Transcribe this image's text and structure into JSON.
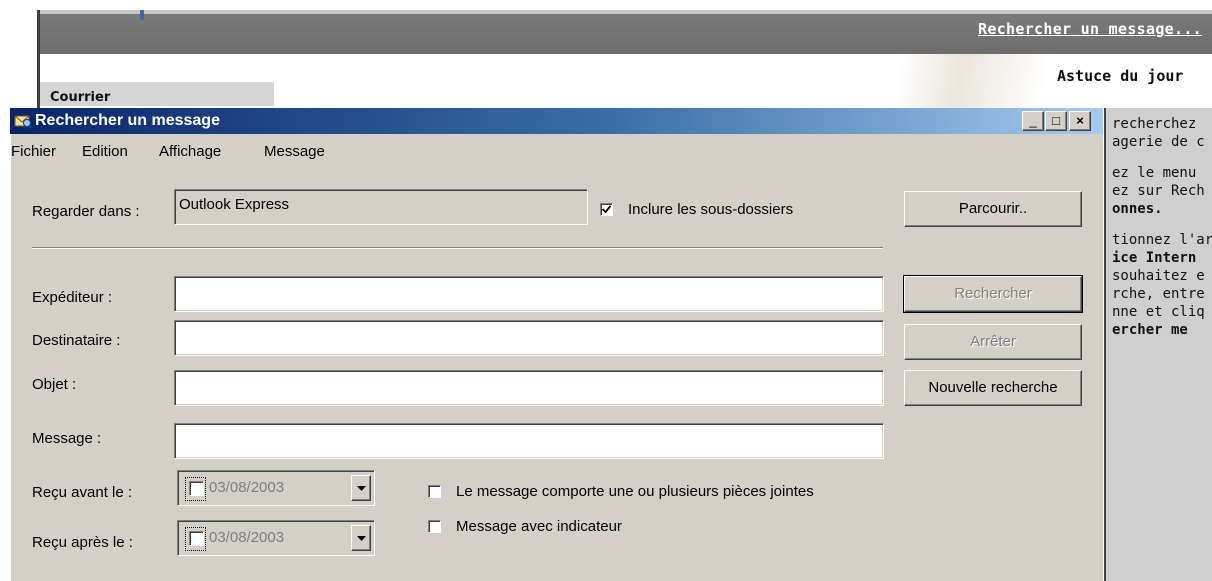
{
  "background": {
    "header_link": "Rechercher un message...",
    "side_tab": "Courrier",
    "tip_title": "Astuce du jour",
    "tip_lines": [
      "recherchez",
      "agerie de c",
      "",
      "ez le menu",
      "ez sur Rech",
      "onnes.",
      "",
      "tionnez l'ar",
      "ice Intern",
      "souhaitez e",
      "rche, entre",
      "nne et cliq",
      "ercher me"
    ]
  },
  "dialog": {
    "title": "Rechercher un message",
    "window_buttons": {
      "minimize": "_",
      "maximize": "□",
      "close": "×"
    },
    "menu": [
      "Fichier",
      "Edition",
      "Affichage",
      "Message"
    ],
    "look_in": {
      "label": "Regarder dans :",
      "value": "Outlook Express",
      "include_subfolders_label": "Inclure les sous-dossiers",
      "include_subfolders_checked": true,
      "browse_button": "Parcourir.."
    },
    "fields": {
      "from": {
        "label": "Expéditeur :",
        "value": ""
      },
      "to": {
        "label": "Destinataire :",
        "value": ""
      },
      "subject": {
        "label": "Objet :",
        "value": ""
      },
      "message": {
        "label": "Message :",
        "value": ""
      }
    },
    "buttons": {
      "search": "Rechercher",
      "stop": "Arrêter",
      "new_search": "Nouvelle recherche"
    },
    "received_before": {
      "label": "Reçu avant le :",
      "date": "03/08/2003",
      "checked": false
    },
    "received_after": {
      "label": "Reçu après le :",
      "date": "03/08/2003",
      "checked": false
    },
    "options": {
      "has_attachments": {
        "label": "Le message comporte une ou plusieurs pièces jointes",
        "checked": false
      },
      "flagged": {
        "label": "Message avec indicateur",
        "checked": false
      }
    }
  }
}
